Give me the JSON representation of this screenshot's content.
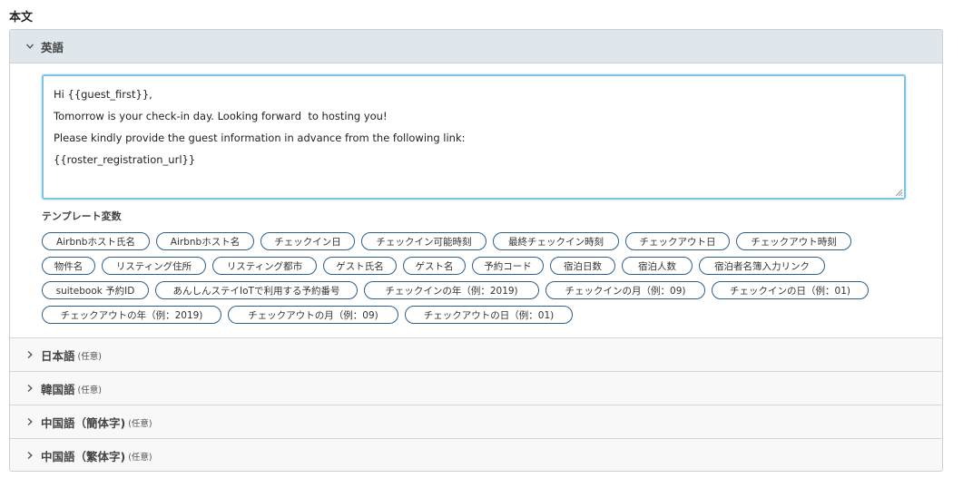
{
  "section_title": "本文",
  "languages": [
    {
      "label": "英語",
      "optional": "",
      "open": true
    },
    {
      "label": "日本語",
      "optional": "(任意)",
      "open": false
    },
    {
      "label": "韓国語",
      "optional": "(任意)",
      "open": false
    },
    {
      "label": "中国語（簡体字)",
      "optional": "(任意)",
      "open": false
    },
    {
      "label": "中国語（繁体字)",
      "optional": "(任意)",
      "open": false
    }
  ],
  "message_lines": [
    "Hi {{guest_first}},",
    "Tomorrow is your check-in day. Looking forward  to hosting you!",
    "Please kindly provide the guest information in advance from the following link:",
    "{{roster_registration_url}}"
  ],
  "template_vars_title": "テンプレート変数",
  "template_vars": [
    [
      "Airbnbホスト氏名",
      "Airbnbホスト名",
      "チェックイン日",
      "チェックイン可能時刻",
      "最終チェックイン時刻",
      "チェックアウト日",
      "チェックアウト時刻"
    ],
    [
      "物件名",
      "リスティング住所",
      "リスティング都市",
      "ゲスト氏名",
      "ゲスト名",
      "予約コード",
      "宿泊日数",
      "宿泊人数",
      "宿泊者名簿入力リンク"
    ],
    [
      "suitebook 予約ID",
      "あんしんステイIoTで利用する予約番号",
      "チェックインの年（例：2019)",
      "チェックインの月（例：09)",
      "チェックインの日（例：01)"
    ],
    [
      "チェックアウトの年（例：2019)",
      "チェックアウトの月（例：09)",
      "チェックアウトの日（例：01)"
    ]
  ],
  "icons": {
    "open": "chevron-down-icon",
    "closed": "chevron-right-icon"
  }
}
